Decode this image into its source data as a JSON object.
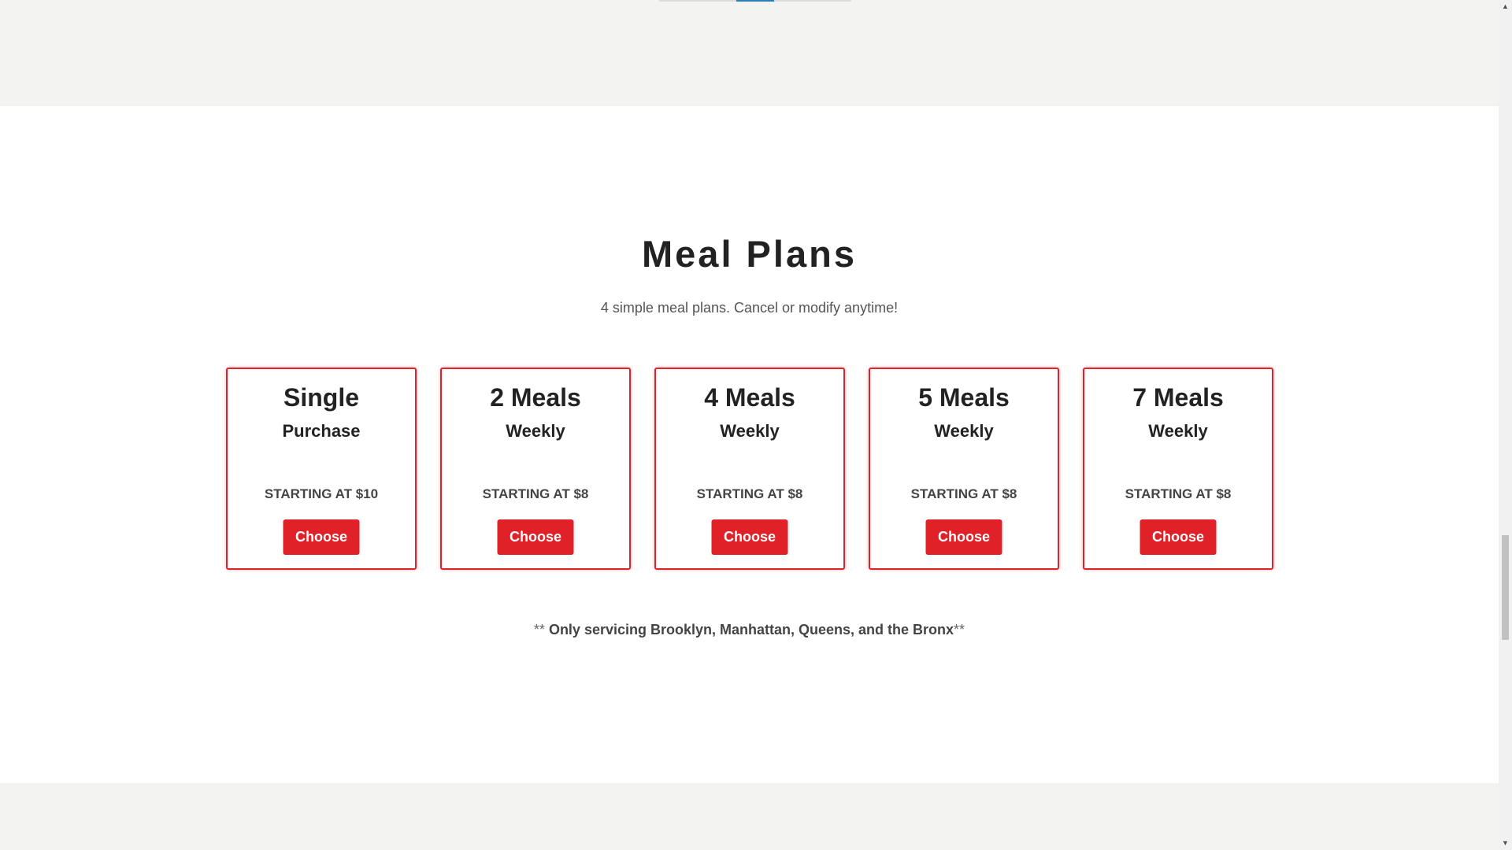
{
  "section": {
    "title": "Meal Plans",
    "subtitle": "4 simple meal plans. Cancel or modify anytime!"
  },
  "plans": [
    {
      "name": "Single",
      "frequency": "Purchase",
      "price": "STARTING AT $10",
      "button": "Choose"
    },
    {
      "name": "2 Meals",
      "frequency": "Weekly",
      "price": "STARTING AT $8",
      "button": "Choose"
    },
    {
      "name": "4 Meals",
      "frequency": "Weekly",
      "price": "STARTING AT $8",
      "button": "Choose"
    },
    {
      "name": "5 Meals",
      "frequency": "Weekly",
      "price": "STARTING AT $8",
      "button": "Choose"
    },
    {
      "name": "7 Meals",
      "frequency": "Weekly",
      "price": "STARTING AT $8",
      "button": "Choose"
    }
  ],
  "note": {
    "prefix": "** ",
    "text": "Only servicing Brooklyn, Manhattan, Queens, and the Bronx",
    "suffix": "**"
  },
  "scrollbar": {
    "up_icon": "▲",
    "down_icon": "▼"
  },
  "colors": {
    "accent": "#e02127",
    "slider_active": "#2a7db8"
  }
}
